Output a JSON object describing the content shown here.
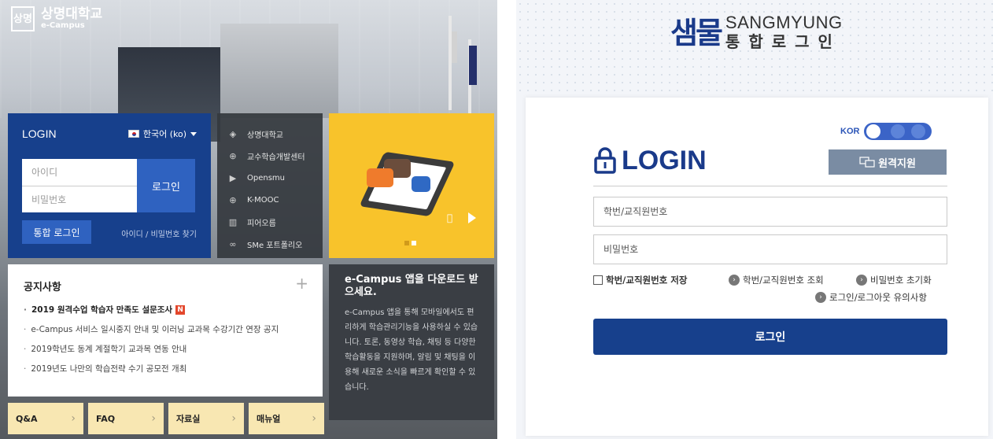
{
  "ecampus": {
    "logo": {
      "mark": "상명",
      "name": "상명대학교",
      "sub": "e-Campus"
    },
    "login": {
      "title": "LOGIN",
      "language": "한국어 (ko)",
      "id_placeholder": "아이디",
      "pw_placeholder": "비밀번호",
      "submit": "로그인",
      "sso": "통합 로그인",
      "find": "아이디 / 비밀번호 찾기"
    },
    "links": [
      {
        "label": "상명대학교",
        "icon": "layers-icon"
      },
      {
        "label": "교수학습개발센터",
        "icon": "globe-icon"
      },
      {
        "label": "Opensmu",
        "icon": "play-icon"
      },
      {
        "label": "K-MOOC",
        "icon": "crosshair-icon"
      },
      {
        "label": "피어오름",
        "icon": "book-icon"
      },
      {
        "label": "SMe 포트폴리오",
        "icon": "link-icon"
      }
    ],
    "notice": {
      "title": "공지사항",
      "items": [
        {
          "text": "2019 원격수업 학습자 만족도 설문조사",
          "new": "N"
        },
        {
          "text": "e-Campus 서비스 일시중지 안내 및 이러닝 교과목 수강기간 연장 공지"
        },
        {
          "text": "2019학년도 동계 계절학기 교과목 연동 안내"
        },
        {
          "text": "2019년도 나만의 학습전략 수기 공모전 개최"
        }
      ]
    },
    "app": {
      "heading": "e-Campus 앱을 다운로드 받으세요.",
      "body": "e-Campus 앱을 통해 모바일에서도 편리하게 학습관리기능을 사용하실 수 있습니다. 토론, 동영상 학습, 채팅 등 다양한 학습활동을 지원하며, 알림 및 채팅을 이용해 새로운 소식을 빠르게 확인할 수 있습니다."
    },
    "tabs": [
      "Q&A",
      "FAQ",
      "자료실",
      "매뉴얼"
    ]
  },
  "sso": {
    "brand": {
      "mark": "샘물",
      "en": "SANGMYUNG",
      "ko": "통합로그인"
    },
    "lang_toggle": "KOR",
    "title": "LOGIN",
    "remote": "원격지원",
    "id_placeholder": "학번/교직원번호",
    "pw_placeholder": "비밀번호",
    "save_id": "학번/교직원번호 저장",
    "lookup_id": "학번/교직원번호 조회",
    "reset_pw": "비밀번호 초기화",
    "notice": "로그인/로그아웃 유의사항",
    "submit": "로그인"
  },
  "colors": {
    "navy": "#17408c",
    "blue": "#2f62c0",
    "yellow": "#f8c32b",
    "dark_panel": "#3a3e44",
    "tab_bg": "#f8e7b2",
    "new_badge": "#e3472c"
  }
}
